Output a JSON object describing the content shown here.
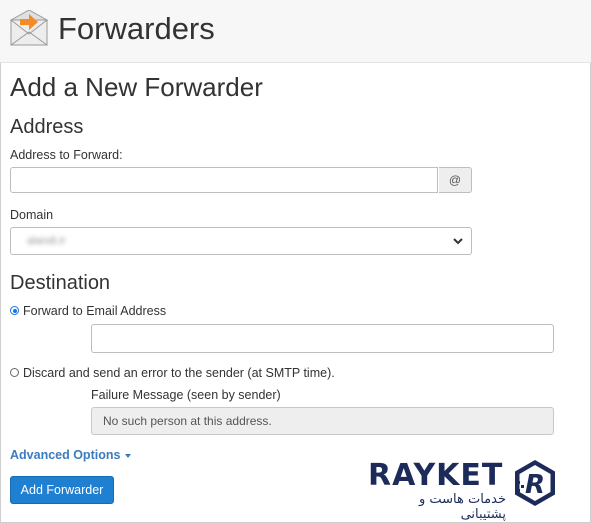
{
  "header": {
    "title": "Forwarders",
    "icon": "envelope-forward-icon"
  },
  "form": {
    "heading": "Add a New Forwarder",
    "address_section": "Address",
    "address_label": "Address to Forward:",
    "address_value": "",
    "at_sign": "@",
    "domain_label": "Domain",
    "domain_value": "alandi.ir",
    "destination_section": "Destination",
    "forward_option_label": "Forward to Email Address",
    "forward_option_selected": true,
    "forward_email_value": "",
    "discard_option_label": "Discard and send an error to the sender (at SMTP time).",
    "discard_option_selected": false,
    "failure_label": "Failure Message (seen by sender)",
    "failure_value": "No such person at this address.",
    "advanced_options": "Advanced Options",
    "submit_label": "Add Forwarder"
  },
  "watermark": {
    "brand": "RAYKET",
    "tagline": "خدمات هاست و پشتیبانی",
    "logo_letter": "R"
  },
  "colors": {
    "accent": "#1f7fd1",
    "link": "#3b7bbf",
    "brand": "#1c2b5a"
  }
}
